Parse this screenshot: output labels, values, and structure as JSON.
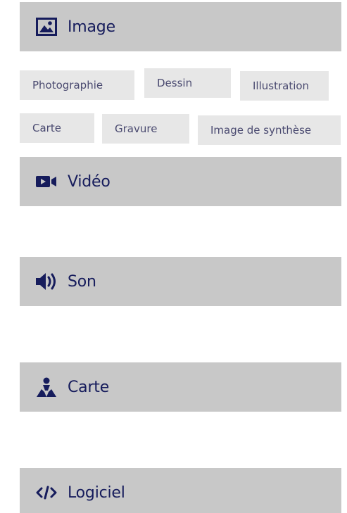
{
  "sections": {
    "image": {
      "label": "Image",
      "icon": "image-icon"
    },
    "video": {
      "label": "Vidéo",
      "icon": "video-camera-icon"
    },
    "son": {
      "label": "Son",
      "icon": "speaker-icon"
    },
    "carte": {
      "label": "Carte",
      "icon": "map-person-icon"
    },
    "logiciel": {
      "label": "Logiciel",
      "icon": "code-icon"
    }
  },
  "image_types": [
    {
      "label": "Photographie"
    },
    {
      "label": "Dessin"
    },
    {
      "label": "Illustration"
    },
    {
      "label": "Carte"
    },
    {
      "label": "Gravure"
    },
    {
      "label": "Image de synthèse"
    }
  ],
  "colors": {
    "header_bg": "#c8c8c8",
    "chip_bg": "#e7e7e7",
    "text": "#161c5c"
  }
}
